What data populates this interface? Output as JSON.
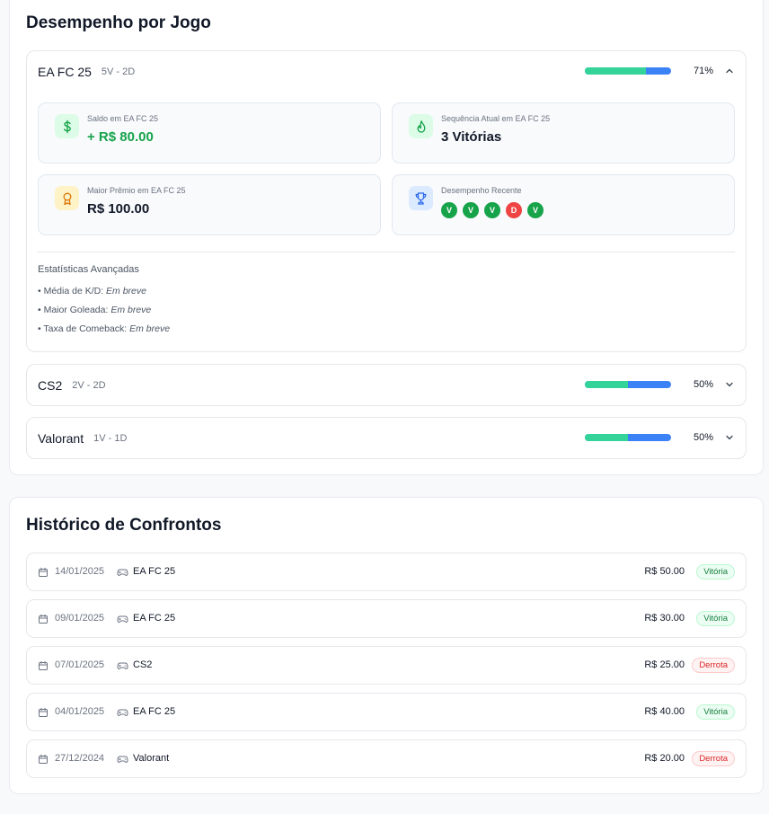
{
  "performance": {
    "title": "Desempenho por Jogo",
    "games": [
      {
        "name": "EA FC 25",
        "record": "5V - 2D",
        "win_fraction": 0.71,
        "percent_label": "71%",
        "expanded": true,
        "stats": {
          "balance_label": "Saldo em EA FC 25",
          "balance_value": "+ R$ 80.00",
          "streak_label": "Sequência Atual em EA FC 25",
          "streak_value": "3 Vitórias",
          "top_prize_label": "Maior Prêmio em EA FC 25",
          "top_prize_value": "R$ 100.00",
          "recent_label": "Desempenho Recente",
          "recent_form": [
            "V",
            "V",
            "V",
            "D",
            "V"
          ]
        },
        "advanced": {
          "title": "Estatísticas Avançadas",
          "items": [
            {
              "label": "• Média de K/D: ",
              "value": "Em breve"
            },
            {
              "label": "• Maior Goleada: ",
              "value": "Em breve"
            },
            {
              "label": "• Taxa de Comeback: ",
              "value": "Em breve"
            }
          ]
        }
      },
      {
        "name": "CS2",
        "record": "2V - 2D",
        "win_fraction": 0.5,
        "percent_label": "50%",
        "expanded": false
      },
      {
        "name": "Valorant",
        "record": "1V - 1D",
        "win_fraction": 0.5,
        "percent_label": "50%",
        "expanded": false
      }
    ]
  },
  "history": {
    "title": "Histórico de Confrontos",
    "matches": [
      {
        "date": "14/01/2025",
        "game": "EA FC 25",
        "amount": "R$ 50.00",
        "result": "Vitória",
        "win": true
      },
      {
        "date": "09/01/2025",
        "game": "EA FC 25",
        "amount": "R$ 30.00",
        "result": "Vitória",
        "win": true
      },
      {
        "date": "07/01/2025",
        "game": "CS2",
        "amount": "R$ 25.00",
        "result": "Derrota",
        "win": false
      },
      {
        "date": "04/01/2025",
        "game": "EA FC 25",
        "amount": "R$ 40.00",
        "result": "Vitória",
        "win": true
      },
      {
        "date": "27/12/2024",
        "game": "Valorant",
        "amount": "R$ 20.00",
        "result": "Derrota",
        "win": false
      }
    ]
  },
  "colors": {
    "win": "#34d399",
    "loss": "#3b82f6",
    "form_win": "#16a34a",
    "form_loss": "#ef4444"
  },
  "icons": {
    "balance": "dollar-icon",
    "streak": "flame-icon",
    "top_prize": "award-icon",
    "recent": "trophy-icon",
    "date": "calendar-icon",
    "game": "gamepad-icon",
    "collapse": "chevron-up-icon",
    "expand": "chevron-down-icon"
  }
}
